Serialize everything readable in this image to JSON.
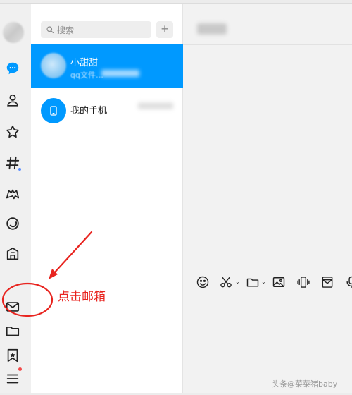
{
  "search": {
    "placeholder": "搜索",
    "add_label": "+"
  },
  "conversations": [
    {
      "name": "小甜甜",
      "preview": "qq文件…",
      "active": true
    },
    {
      "name": "我的手机",
      "active": false
    }
  ],
  "annotation": {
    "text": "点击邮箱"
  },
  "watermark": "头条@菜菜猪baby",
  "colors": {
    "accent": "#0099ff",
    "annotation": "#e8241f",
    "notification_dot": "#f24a4a"
  },
  "rail_icons": [
    "chat-icon",
    "contacts-icon",
    "star-icon",
    "channel-icon",
    "game-icon",
    "circle-icon",
    "mini-app-icon",
    "mail-icon",
    "folder-icon",
    "bookmark-icon",
    "menu-icon"
  ],
  "toolbar_icons": [
    "emoji-icon",
    "scissors-icon",
    "folder-icon",
    "image-icon",
    "shake-icon",
    "mail-icon",
    "mic-icon"
  ]
}
